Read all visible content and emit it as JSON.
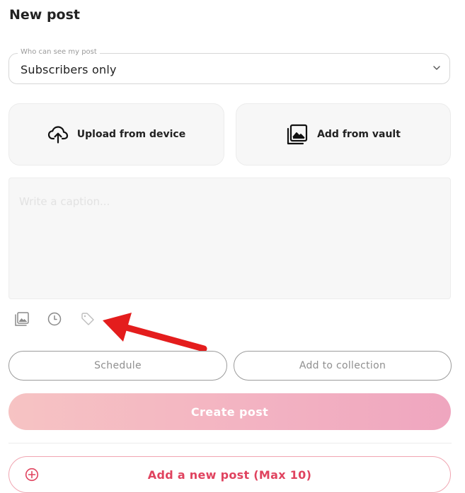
{
  "page": {
    "title": "New post"
  },
  "audience": {
    "legend": "Who can see my post",
    "value": "Subscribers only"
  },
  "upload": {
    "device_label": "Upload from device",
    "vault_label": "Add from vault"
  },
  "caption": {
    "placeholder": "Write a caption..."
  },
  "toolbar": {
    "icons": [
      "media-icon",
      "clock-icon",
      "tag-icon"
    ]
  },
  "actions": {
    "schedule_label": "Schedule",
    "collection_label": "Add to collection",
    "create_label": "Create post",
    "add_post_label": "Add a new post (Max 10)"
  },
  "colors": {
    "accent": "#e0435f",
    "create_gradient_start": "#f6c3c3",
    "create_gradient_end": "#efa6bf",
    "annotation_arrow": "#e41d1d"
  }
}
